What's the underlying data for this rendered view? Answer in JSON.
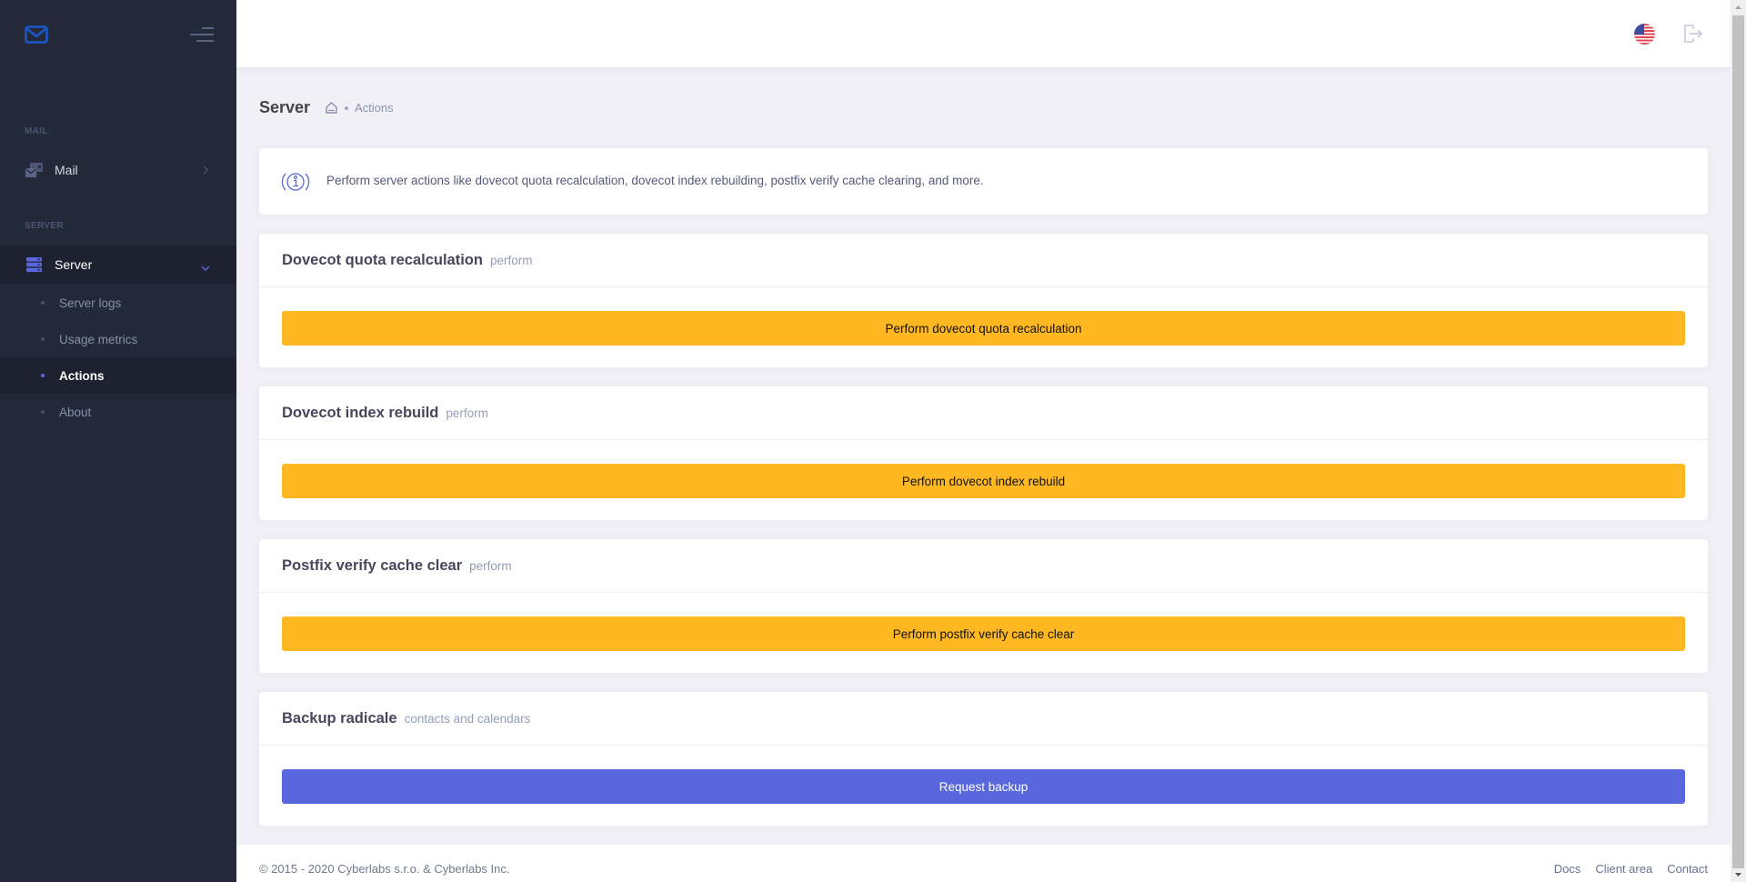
{
  "sidebar": {
    "sections": [
      {
        "label": "MAIL"
      },
      {
        "label": "SERVER"
      }
    ],
    "items": [
      {
        "label": "Mail",
        "icon": "mail-stack-icon",
        "chevron": "chevron-right-icon"
      },
      {
        "label": "Server",
        "icon": "server-icon",
        "chevron": "chevron-down-icon"
      }
    ],
    "subitems": [
      {
        "label": "Server logs"
      },
      {
        "label": "Usage metrics"
      },
      {
        "label": "Actions"
      },
      {
        "label": "About"
      }
    ],
    "accent": "#5867dd"
  },
  "header": {
    "language_icon": "us-flag-icon",
    "logout_icon": "logout-icon"
  },
  "subheader": {
    "title": "Server",
    "breadcrumb": [
      "home",
      "Actions"
    ]
  },
  "alert": {
    "icon": "info-icon",
    "text": "Perform server actions like dovecot quota recalculation, dovecot index rebuilding, postfix verify cache clearing, and more."
  },
  "cards": [
    {
      "title": "Dovecot quota recalculation",
      "subtitle": "perform",
      "button": "Perform dovecot quota recalculation",
      "button_color": "#ffb822"
    },
    {
      "title": "Dovecot index rebuild",
      "subtitle": "perform",
      "button": "Perform dovecot index rebuild",
      "button_color": "#ffb822"
    },
    {
      "title": "Postfix verify cache clear",
      "subtitle": "perform",
      "button": "Perform postfix verify cache clear",
      "button_color": "#ffb822"
    },
    {
      "title": "Backup radicale",
      "subtitle": "contacts and calendars",
      "button": "Request backup",
      "button_color": "#5867dd"
    }
  ],
  "footer": {
    "copyright": "© 2015 - 2020 Cyberlabs s.r.o. & Cyberlabs Inc.",
    "links": [
      "Docs",
      "Client area",
      "Contact"
    ]
  }
}
